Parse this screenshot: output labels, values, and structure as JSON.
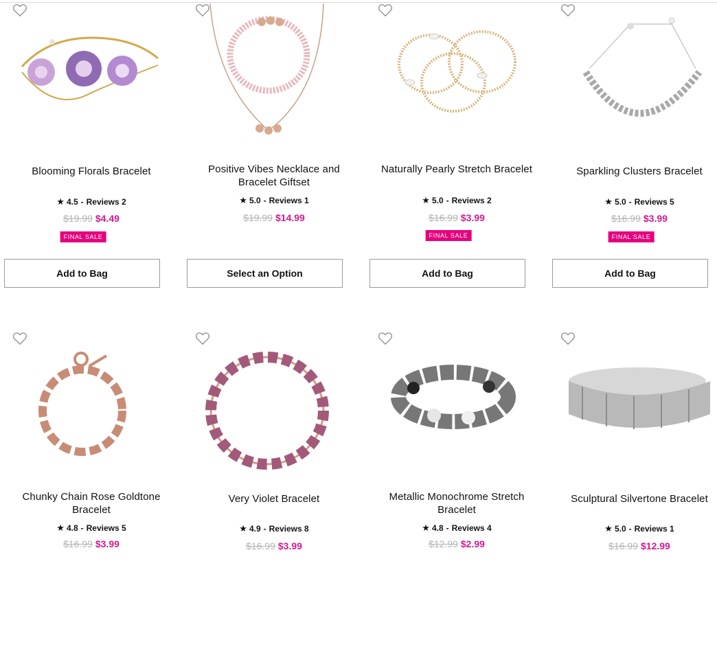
{
  "products": [
    {
      "name": "Blooming Florals Bracelet",
      "rating": "4.5",
      "reviews": "Reviews 2",
      "old_price": "$19.99",
      "price": "$4.49",
      "badge": "FINAL SALE",
      "button": "Add to Bag"
    },
    {
      "name": "Positive Vibes Necklace and Bracelet Giftset",
      "rating": "5.0",
      "reviews": "Reviews 1",
      "old_price": "$19.99",
      "price": "$14.99",
      "badge": "",
      "button": "Select an Option"
    },
    {
      "name": "Naturally Pearly Stretch Bracelet",
      "rating": "5.0",
      "reviews": "Reviews 2",
      "old_price": "$16.99",
      "price": "$3.99",
      "badge": "FINAL SALE",
      "button": "Add to Bag"
    },
    {
      "name": "Sparkling Clusters Bracelet",
      "rating": "5.0",
      "reviews": "Reviews 5",
      "old_price": "$16.99",
      "price": "$3.99",
      "badge": "FINAL SALE",
      "button": "Add to Bag"
    },
    {
      "name": "Chunky Chain Rose Goldtone Bracelet",
      "rating": "4.8",
      "reviews": "Reviews 5",
      "old_price": "$16.99",
      "price": "$3.99",
      "badge": "",
      "button": ""
    },
    {
      "name": "Very Violet Bracelet",
      "rating": "4.9",
      "reviews": "Reviews 8",
      "old_price": "$16.99",
      "price": "$3.99",
      "badge": "",
      "button": ""
    },
    {
      "name": "Metallic Monochrome Stretch Bracelet",
      "rating": "4.8",
      "reviews": "Reviews 4",
      "old_price": "$12.99",
      "price": "$2.99",
      "badge": "",
      "button": ""
    },
    {
      "name": "Sculptural Silvertone Bracelet",
      "rating": "5.0",
      "reviews": "Reviews 1",
      "old_price": "$16.99",
      "price": "$12.99",
      "badge": "",
      "button": ""
    }
  ],
  "icons": {
    "wishlist": "heart-outline-icon",
    "rating": "star-icon"
  },
  "colors": {
    "sale_price": "#d11a91",
    "badge_bg": "#e6007e",
    "old_price": "#b3b3b3",
    "button_border": "#9a9a9a"
  }
}
